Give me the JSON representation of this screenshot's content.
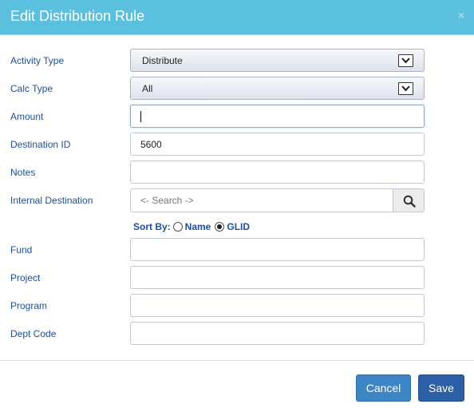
{
  "dialog": {
    "title": "Edit Distribution Rule",
    "close_glyph": "×"
  },
  "fields": {
    "activity_type": {
      "label": "Activity Type",
      "value": "Distribute"
    },
    "calc_type": {
      "label": "Calc Type",
      "value": "All"
    },
    "amount": {
      "label": "Amount",
      "value": ""
    },
    "destination_id": {
      "label": "Destination ID",
      "value": "5600"
    },
    "notes": {
      "label": "Notes",
      "value": ""
    },
    "internal_destination": {
      "label": "Internal Destination",
      "placeholder": "<- Search ->"
    },
    "fund": {
      "label": "Fund",
      "value": ""
    },
    "project": {
      "label": "Project",
      "value": ""
    },
    "program": {
      "label": "Program",
      "value": ""
    },
    "dept_code": {
      "label": "Dept Code",
      "value": ""
    }
  },
  "sort": {
    "label": "Sort By:",
    "options": [
      {
        "label": "Name",
        "selected": false
      },
      {
        "label": "GLID",
        "selected": true
      }
    ]
  },
  "buttons": {
    "cancel": "Cancel",
    "save": "Save"
  },
  "colors": {
    "header": "#5bc0de",
    "label": "#1c4f9c",
    "cancel": "#3c86c6",
    "save": "#2d5fa6"
  },
  "icons": {
    "search": "search-icon",
    "dropdown": "chevron-down-icon",
    "close": "close-icon"
  }
}
